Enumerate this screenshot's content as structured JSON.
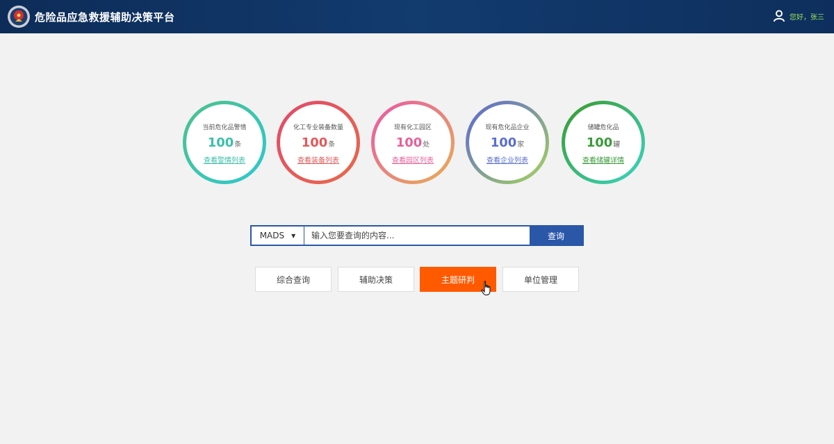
{
  "header": {
    "title": "危险品应急救援辅助决策平台",
    "user_text": "您好，张三",
    "logo_icon": "emblem-icon",
    "user_icon": "user-icon"
  },
  "stats": [
    {
      "label": "当前危化品警情",
      "value": "100",
      "unit": "条",
      "link": "查看警情列表",
      "color": "#3cbfa9",
      "gradient": [
        "#4cc18a",
        "#2ec9d0"
      ]
    },
    {
      "label": "化工专业装备数量",
      "value": "100",
      "unit": "条",
      "link": "查看装备列表",
      "color": "#e05a5a",
      "gradient": [
        "#e04a6a",
        "#e86a4a"
      ]
    },
    {
      "label": "现有化工园区",
      "value": "100",
      "unit": "处",
      "link": "查看园区列表",
      "color": "#e8609a",
      "gradient": [
        "#e857a8",
        "#e8b052"
      ]
    },
    {
      "label": "现有危化品企业",
      "value": "100",
      "unit": "家",
      "link": "查看企业列表",
      "color": "#5a6fcf",
      "gradient": [
        "#5a64d6",
        "#a6d65a"
      ]
    },
    {
      "label": "储罐危化品",
      "value": "100",
      "unit": "罐",
      "link": "查看储罐详情",
      "color": "#3a9a3a",
      "gradient": [
        "#3a9a2a",
        "#3ad6c6"
      ]
    }
  ],
  "search": {
    "select_value": "MADS",
    "placeholder": "输入您要查询的内容...",
    "button_label": "查询"
  },
  "nav": {
    "buttons": [
      "综合查询",
      "辅助决策",
      "主题研判",
      "单位管理"
    ],
    "active_index": 2,
    "active_color": "#ff5a00"
  }
}
